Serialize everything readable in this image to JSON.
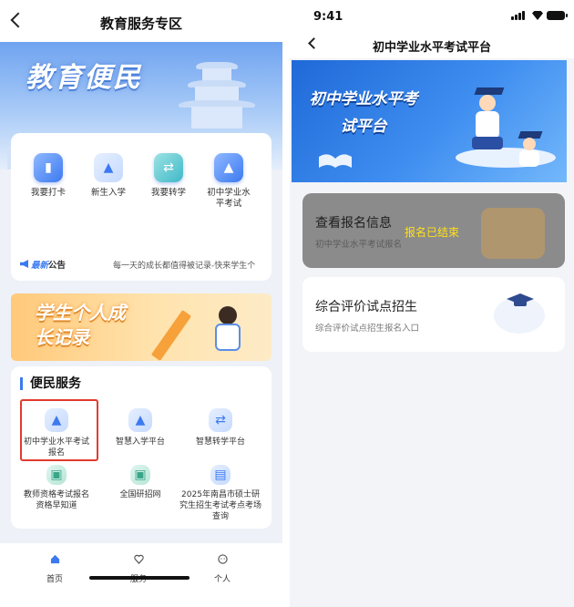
{
  "left": {
    "title": "教育服务专区",
    "hero_text": "教育便民",
    "services": [
      {
        "label": "我要打卡",
        "icon": "book-icon"
      },
      {
        "label": "新生入学",
        "icon": "graduation-cap-icon"
      },
      {
        "label": "我要转学",
        "icon": "transfer-icon"
      },
      {
        "label": "初中学业水平考试",
        "icon": "exam-cap-icon"
      }
    ],
    "notice": {
      "brand_prefix": "最新",
      "brand_suffix": "公告",
      "text": "每一天的成长都值得被记录-快来学生个"
    },
    "banner2_text": "学生个人成长记录",
    "convenience": {
      "title": "便民服务",
      "items": [
        {
          "label": "初中学业水平考试报名",
          "icon": "exam-cap-icon"
        },
        {
          "label": "智慧入学平台",
          "icon": "graduation-cap-icon"
        },
        {
          "label": "智慧转学平台",
          "icon": "transfer-icon"
        },
        {
          "label": "教师资格考试报名资格早知道",
          "icon": "certificate-icon"
        },
        {
          "label": "全国研招网",
          "icon": "web-icon"
        },
        {
          "label": "2025年南昌市硕士研究生招生考试考点考场查询",
          "icon": "document-icon"
        }
      ]
    },
    "tabs": [
      {
        "label": "首页",
        "icon": "home-icon"
      },
      {
        "label": "服务",
        "icon": "heart-icon"
      },
      {
        "label": "个人",
        "icon": "person-icon"
      }
    ]
  },
  "right": {
    "status_time": "9:41",
    "title": "初中学业水平考试平台",
    "banner_text": "初中学业水平考试平台",
    "cards": [
      {
        "title": "查看报名信息",
        "subtitle": "初中学业水平考试报名",
        "status": "报名已结束"
      },
      {
        "title": "综合评价试点招生",
        "subtitle": "综合评价试点招生报名入口"
      }
    ]
  },
  "colors": {
    "accent": "#3d7af0",
    "highlight_border": "#e23b2e",
    "ended_text": "#ffe11a",
    "disabled_card": "#8b8b8b"
  }
}
